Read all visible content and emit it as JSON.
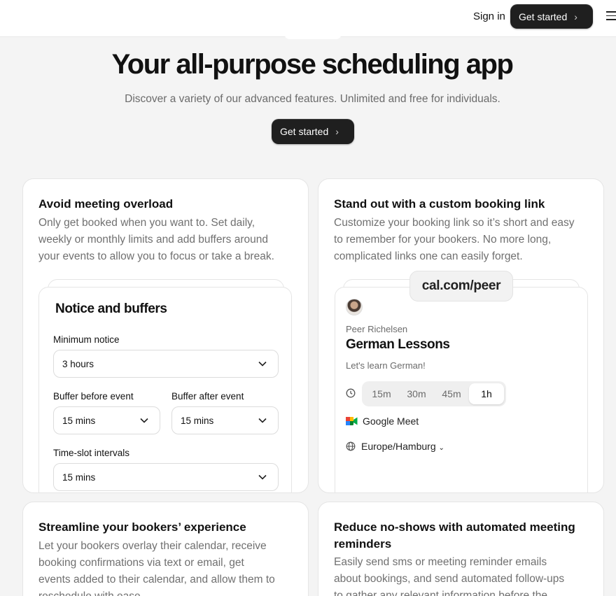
{
  "header": {
    "sign_in": "Sign in",
    "cta": "Get started"
  },
  "hero": {
    "title": "Your all-purpose scheduling app",
    "subtitle": "Discover a variety of our advanced features. Unlimited and free for individuals.",
    "cta": "Get started"
  },
  "cards": {
    "overload": {
      "title": "Avoid meeting overload",
      "desc_lines": [
        "Only get booked when you want to. Set daily,",
        "weekly or monthly limits and add buffers around",
        "your events to allow you to focus or take a break."
      ],
      "panel": {
        "title": "Notice and buffers",
        "minimum_notice_label": "Minimum notice",
        "minimum_notice_value": "3 hours",
        "buffer_before_label": "Buffer before event",
        "buffer_before_value": "15 mins",
        "buffer_after_label": "Buffer after event",
        "buffer_after_value": "15 mins",
        "interval_label": "Time-slot intervals",
        "interval_value": "15 mins"
      }
    },
    "booking_link": {
      "title": "Stand out with a custom booking link",
      "desc_lines": [
        "Customize your booking link so it’s short and easy",
        "to remember for your bookers. No more long,",
        "complicated links one can easily forget."
      ],
      "url": "cal.com/peer",
      "host": "Peer Richelsen",
      "event_title": "German Lessons",
      "event_desc": "Let's learn German!",
      "durations": [
        "15m",
        "30m",
        "45m",
        "1h"
      ],
      "selected_duration": "1h",
      "location": "Google Meet",
      "timezone": "Europe/Hamburg"
    },
    "bookers": {
      "title": "Streamline your bookers’ experience",
      "desc_lines": [
        "Let your bookers overlay their calendar, receive",
        "booking confirmations via text or email, get",
        "events added to their calendar, and allow them to",
        "reschedule with ease."
      ]
    },
    "reminders": {
      "title_lines": [
        "Reduce no-shows with automated meeting",
        "reminders"
      ],
      "desc_lines": [
        "Easily send sms or meeting reminder emails",
        "about bookings, and send automated follow-ups",
        "to gather any relevant information before the"
      ]
    }
  },
  "icons": {
    "menu": "menu-icon",
    "chevron": "chevron-right-icon",
    "select_arrow": "chevron-down-icon",
    "clock": "clock-icon",
    "video": "google-meet-icon",
    "globe": "globe-icon"
  }
}
